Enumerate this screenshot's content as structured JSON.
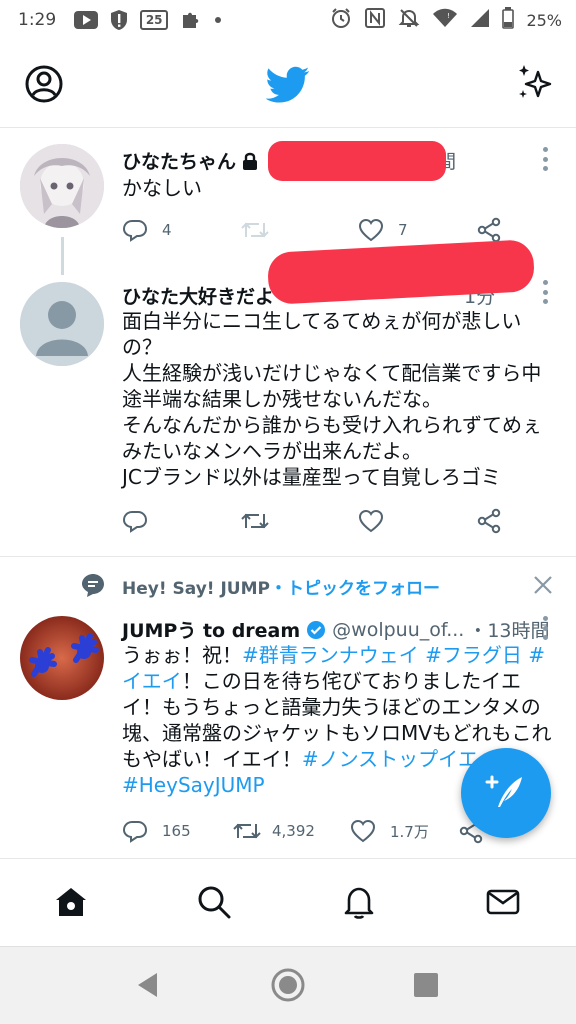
{
  "status_bar": {
    "time": "1:29",
    "notification_badge": "25",
    "battery": "25%",
    "icons": [
      "youtube-icon",
      "shield-alert-icon",
      "calendar-25-icon",
      "puzzle-icon",
      "dot-icon",
      "alarm-icon",
      "nfc-icon",
      "mute-icon",
      "wifi-icon",
      "signal-icon",
      "battery-icon"
    ]
  },
  "header": {
    "icons": [
      "profile-icon",
      "twitter-bird-icon",
      "sparkle-icon"
    ],
    "brand_color": "#1d9bf0"
  },
  "tweets": [
    {
      "name": "ひなたちゃん",
      "locked": true,
      "time": "5時間",
      "text": "かなしい",
      "reply_count": "4",
      "retweet_count": "",
      "like_count": "7"
    },
    {
      "name": "ひなた大好きだよ",
      "time": "1分",
      "lines": [
        "面白半分にニコ生してるてめぇが何が悲しい",
        "の？",
        "人生経験が浅いだけじゃなくて配信業ですら中",
        "途半端な結果しか残せないんだな。",
        "そんなんだから誰からも受け入れられずてめぇ",
        "みたいなメンヘラが出来んだよ。",
        "JCブランド以外は量産型って自覚しろゴミ"
      ]
    },
    {
      "topic": "Hey! Say! JUMP",
      "topic_action": "・トピックをフォロー",
      "name": "JUMPう to dream",
      "verified": true,
      "handle": "@wolpuu_of...",
      "time": "・13時間",
      "segments": {
        "t1": "うぉぉ！祝！",
        "h1": "#群青ランナウェイ",
        "s1": " ",
        "h2": "#フラグ日",
        "s2": " ",
        "h3": "#",
        "h4": "イエイ",
        "t2": "！この日を待ち侘びておりましたイエイ！もうちょっと語彙力失うほどのエンタメの塊、通常盤のジャケットもソロMVもどれもこれもやばい！イエイ！",
        "h5": "#ノンストップイエ",
        "h6": "#HeySayJUMP"
      },
      "reply_count": "165",
      "retweet_count": "4,392",
      "like_count": "1.7万"
    }
  ],
  "bottom_nav": [
    "home-icon",
    "search-icon",
    "bell-icon",
    "mail-icon"
  ],
  "system_nav": [
    "back-icon",
    "home-circle-icon",
    "recents-icon"
  ],
  "colors": {
    "hashtag": "#1d9bf0",
    "redaction": "#f8364b",
    "muted": "#536471"
  }
}
